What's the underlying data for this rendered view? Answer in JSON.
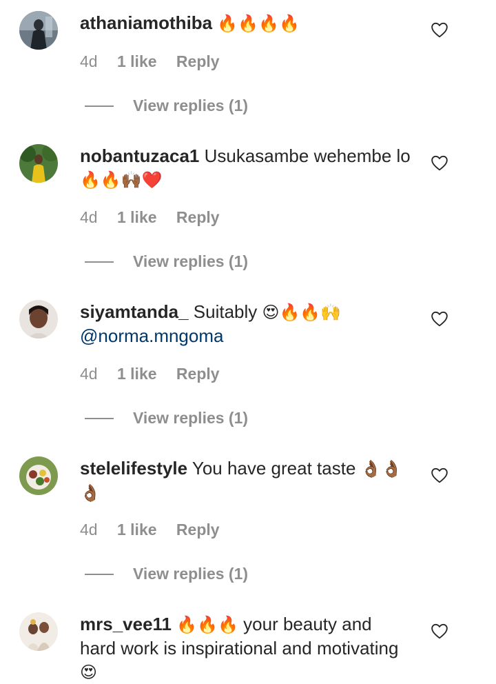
{
  "comments": [
    {
      "username": "athaniamothiba",
      "text": "",
      "emoji": "🔥🔥🔥🔥",
      "time": "4d",
      "likes": "1 like",
      "reply": "Reply",
      "view_replies": "View replies (1)"
    },
    {
      "username": "nobantuzaca1",
      "text": "Usukasambe wehembe lo",
      "emoji": "🔥🔥🙌🏾❤️",
      "time": "4d",
      "likes": "1 like",
      "reply": "Reply",
      "view_replies": "View replies (1)"
    },
    {
      "username": "siyamtanda_",
      "text": "Suitably",
      "emoji": "😍🔥🔥🙌",
      "mention": "@norma.mngoma",
      "time": "4d",
      "likes": "1 like",
      "reply": "Reply",
      "view_replies": "View replies (1)"
    },
    {
      "username": "stelelifestyle",
      "text": "You have great taste",
      "emoji": "👌🏾👌🏾👌🏾",
      "time": "4d",
      "likes": "1 like",
      "reply": "Reply",
      "view_replies": "View replies (1)"
    },
    {
      "username": "mrs_vee11",
      "emoji_lead": "🔥🔥🔥",
      "text": "your beauty and hard work is inspirational and motivating",
      "emoji": "😍"
    }
  ],
  "icons": {
    "like": "heart-outline-icon"
  },
  "colors": {
    "text": "#262626",
    "secondary": "#8e8e8e",
    "mention": "#00376b"
  }
}
